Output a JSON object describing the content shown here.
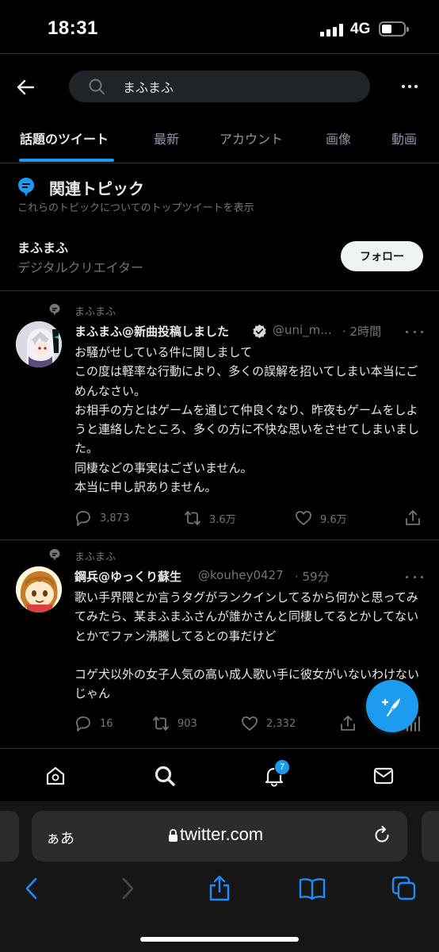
{
  "status_bar": {
    "time": "18:31",
    "network": "4G"
  },
  "header": {
    "search_query": "まふまふ",
    "search_icon": "search-icon",
    "back_icon": "arrow-left-icon",
    "more_icon": "more-horizontal-icon"
  },
  "tabs": [
    {
      "label": "話題のツイート",
      "active": true
    },
    {
      "label": "最新",
      "active": false
    },
    {
      "label": "アカウント",
      "active": false
    },
    {
      "label": "画像",
      "active": false
    },
    {
      "label": "動画",
      "active": false
    }
  ],
  "topics": {
    "title": "関連トピック",
    "subtitle": "これらのトピックについてのトップツイートを表示",
    "name": "まふまふ",
    "category": "デジタルクリエイター",
    "follow_label": "フォロー"
  },
  "tweets": [
    {
      "context": "まふまふ",
      "name": "まふまふ@新曲投稿しました",
      "verified": true,
      "handle": "@uni_m...",
      "time": "· 2時間",
      "body": "お騒がせしている件に関しまして\nこの度は軽率な行動により、多くの誤解を招いてしまい本当にごめんなさい。\nお相手の方とはゲームを通じて仲良くなり、昨夜もゲームをしようと連絡したところ、多くの方に不快な思いをさせてしまいました。\n同棲などの事実はございません。\n本当に申し訳ありません。",
      "replies": "3,873",
      "retweets": "3.6万",
      "likes": "9.6万"
    },
    {
      "context": "まふまふ",
      "name": "鋼兵@ゆっくり蘇生",
      "verified": false,
      "handle": "@kouhey0427",
      "time": "· 59分",
      "body": "歌い手界隈とか言うタグがランクインしてるから何かと思ってみてみたら、某まふまふさんが誰かさんと同棲してるとかしてないとかでファン沸騰してるとの事だけど\n\nコゲ犬以外の女子人気の高い成人歌い手に彼女がいないわけないじゃん",
      "replies": "16",
      "retweets": "903",
      "likes": "2,332"
    }
  ],
  "bottom_nav": {
    "notification_count": "7"
  },
  "safari": {
    "aa_label": "ぁあ",
    "url": "twitter.com"
  },
  "colors": {
    "accent": "#1d9bf0",
    "background": "#000000",
    "muted": "#71767b"
  }
}
